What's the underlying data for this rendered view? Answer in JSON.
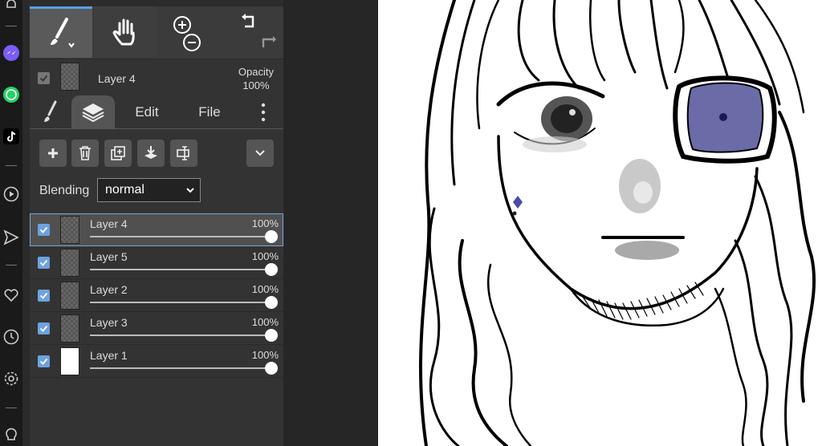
{
  "browser_sidebar": {
    "icons": [
      "bell-icon",
      "messenger-icon",
      "whatsapp-icon",
      "tiktok-icon",
      "play-circle-icon",
      "send-icon",
      "heart-icon",
      "clock-icon",
      "settings-icon",
      "lightbulb-icon"
    ]
  },
  "toolbar": {
    "active_tool": "brush",
    "tools": [
      "brush-icon",
      "hand-icon",
      "zoom-in-icon",
      "zoom-out-icon",
      "undo-icon",
      "redo-icon"
    ]
  },
  "current_layer": {
    "name": "Layer 4",
    "opacity_label": "Opacity",
    "opacity_value": "100%"
  },
  "tabs": {
    "edit": "Edit",
    "file": "File"
  },
  "blending": {
    "label": "Blending",
    "value": "normal"
  },
  "layers": [
    {
      "name": "Layer 4",
      "opacity": "100%",
      "level": 1.0,
      "selected": true,
      "thumb": "transparent"
    },
    {
      "name": "Layer 5",
      "opacity": "100%",
      "level": 1.0,
      "selected": false,
      "thumb": "transparent"
    },
    {
      "name": "Layer 2",
      "opacity": "100%",
      "level": 1.0,
      "selected": false,
      "thumb": "transparent"
    },
    {
      "name": "Layer 3",
      "opacity": "100%",
      "level": 1.0,
      "selected": false,
      "thumb": "transparent"
    },
    {
      "name": "Layer 1",
      "opacity": "100%",
      "level": 1.0,
      "selected": false,
      "thumb": "white"
    }
  ],
  "colors": {
    "accent": "#6da2e0",
    "panel": "#333333",
    "eyepatch": "#6b6ba8"
  }
}
